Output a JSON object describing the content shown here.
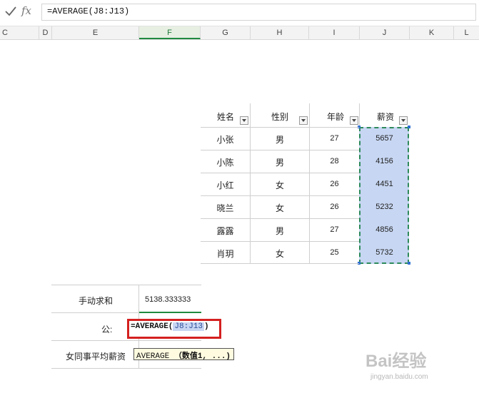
{
  "formula_bar": {
    "formula": "=AVERAGE(J8:J13)",
    "fx_label": "fx"
  },
  "columns": [
    {
      "label": "C"
    },
    {
      "label": "D"
    },
    {
      "label": "E"
    },
    {
      "label": "F"
    },
    {
      "label": "G"
    },
    {
      "label": "H"
    },
    {
      "label": "I"
    },
    {
      "label": "J"
    },
    {
      "label": "K"
    },
    {
      "label": "L"
    }
  ],
  "table": {
    "headers": [
      "姓名",
      "性别",
      "年龄",
      "薪资"
    ],
    "rows": [
      [
        "小张",
        "男",
        "27",
        "5657"
      ],
      [
        "小陈",
        "男",
        "28",
        "4156"
      ],
      [
        "小红",
        "女",
        "26",
        "4451"
      ],
      [
        "晓兰",
        "女",
        "26",
        "5232"
      ],
      [
        "露露",
        "男",
        "27",
        "4856"
      ],
      [
        "肖玥",
        "女",
        "25",
        "5732"
      ]
    ]
  },
  "summary": {
    "row1_label": "手动求和",
    "row1_value": "5138.333333",
    "row2_label": "公:",
    "row3_label": "女同事平均薪资"
  },
  "editing": {
    "prefix": "=AVERAGE(",
    "ref": "J8:J13",
    "suffix": ")"
  },
  "tooltip": {
    "func": "AVERAGE",
    "args": "（数值1, ...)"
  },
  "watermark": {
    "logo": "Bai经验",
    "url": "jingyan.baidu.com"
  }
}
